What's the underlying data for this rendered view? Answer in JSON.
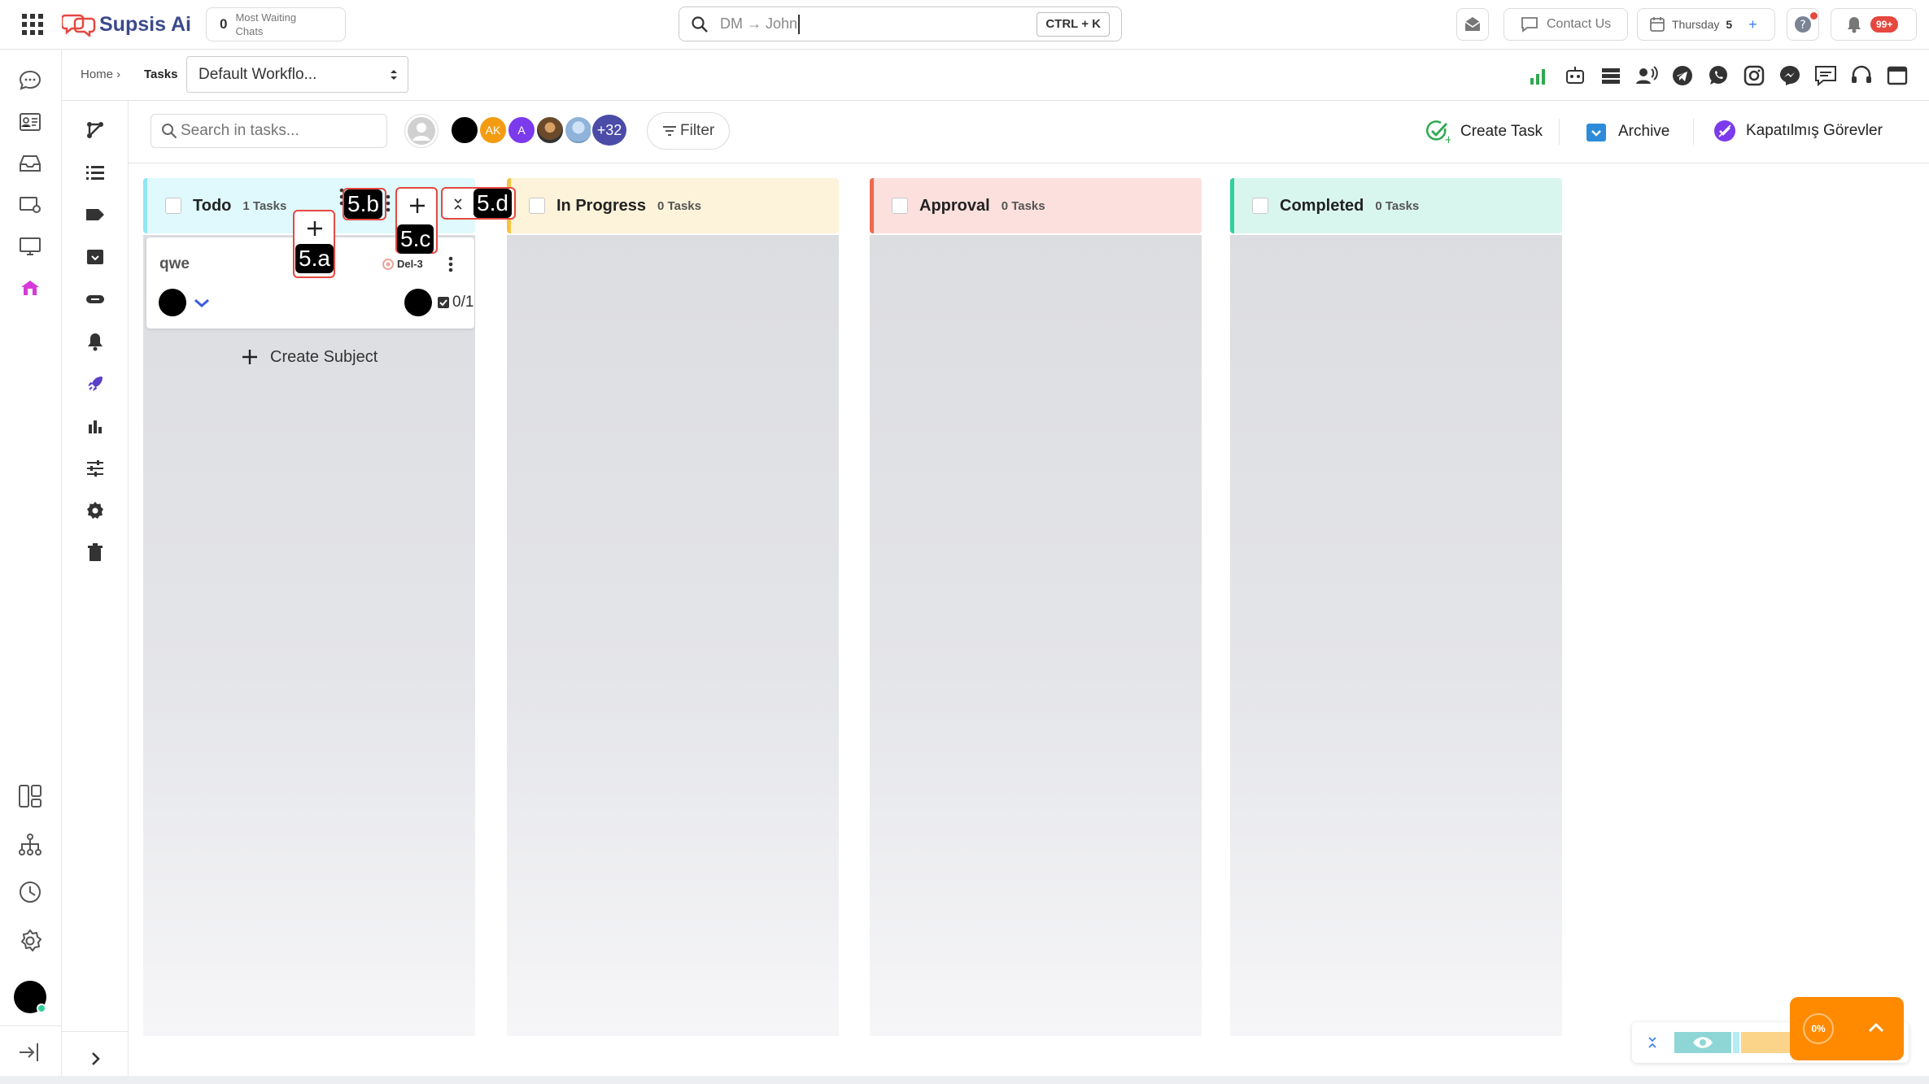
{
  "app": {
    "logo_text": "Supsis Ai"
  },
  "topbar": {
    "waiting_count": "0",
    "waiting_label_1": "Most Waiting",
    "waiting_label_2": "Chats",
    "search_text": "DM → John",
    "search_shortcut": "CTRL + K",
    "contact_us": "Contact Us",
    "day_label": "Thursday",
    "day_number": "5",
    "notif_badge": "99+"
  },
  "breadcrumb": {
    "home": "Home ›",
    "current": "Tasks",
    "workflow": "Default Workflo..."
  },
  "toolbar": {
    "search_placeholder": "Search in tasks...",
    "avatar_ak": "AK",
    "avatar_a": "A",
    "more_count": "+32",
    "filter": "Filter",
    "create_task": "Create Task",
    "archive": "Archive",
    "closed_tasks": "Kapatılmış Görevler"
  },
  "columns": [
    {
      "title": "Todo",
      "count": "1 Tasks",
      "color": "#8fe8f2"
    },
    {
      "title": "In Progress",
      "count": "0 Tasks",
      "color": "#f5c242"
    },
    {
      "title": "Approval",
      "count": "0 Tasks",
      "color": "#f0684f"
    },
    {
      "title": "Completed",
      "count": "0 Tasks",
      "color": "#2fcf9e"
    }
  ],
  "card": {
    "title": "qwe",
    "code": "Del-3",
    "progress": "0/1"
  },
  "create_subject": "Create Subject",
  "annotations": {
    "a": "5.a",
    "b": "5.b",
    "c": "5.c",
    "d": "5.d"
  },
  "widget": {
    "percent": "0%"
  },
  "colors": {
    "accent": "#3b5bdb",
    "brand_red": "#e5483f",
    "orange": "#ff8a00"
  }
}
